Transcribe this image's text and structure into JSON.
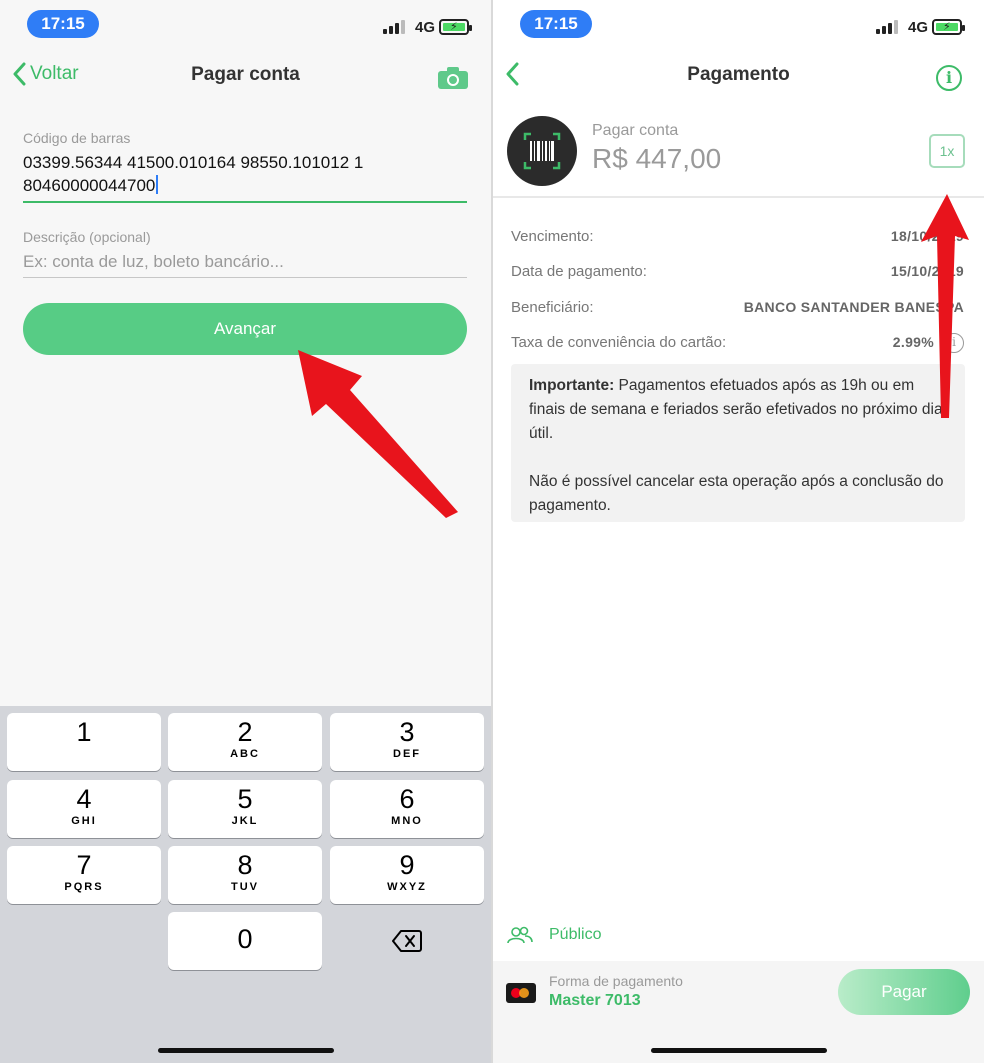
{
  "left_screen": {
    "status": {
      "time": "17:15",
      "network": "4G"
    },
    "nav": {
      "back_label": "Voltar",
      "title": "Pagar conta",
      "camera_icon": "camera-icon"
    },
    "barcode": {
      "label": "Código de barras",
      "value_line1": "03399.56344 41500.010164 98550.101012 1",
      "value_line2": "80460000044700"
    },
    "description": {
      "label": "Descrição (opcional)",
      "placeholder": "Ex: conta de luz, boleto bancário..."
    },
    "submit_label": "Avançar",
    "keypad": [
      {
        "num": "1",
        "letters": ""
      },
      {
        "num": "2",
        "letters": "ABC"
      },
      {
        "num": "3",
        "letters": "DEF"
      },
      {
        "num": "4",
        "letters": "GHI"
      },
      {
        "num": "5",
        "letters": "JKL"
      },
      {
        "num": "6",
        "letters": "MNO"
      },
      {
        "num": "7",
        "letters": "PQRS"
      },
      {
        "num": "8",
        "letters": "TUV"
      },
      {
        "num": "9",
        "letters": "WXYZ"
      },
      {
        "num": "0",
        "letters": ""
      }
    ]
  },
  "right_screen": {
    "status": {
      "time": "17:15",
      "network": "4G"
    },
    "nav": {
      "title": "Pagamento",
      "info_glyph": "i"
    },
    "summary": {
      "label": "Pagar conta",
      "amount": "R$ 447,00",
      "installments": "1x"
    },
    "details": [
      {
        "label": "Vencimento:",
        "value": "18/10/2019"
      },
      {
        "label": "Data de pagamento:",
        "value": "15/10/2019"
      },
      {
        "label": "Beneficiário:",
        "value": "BANCO SANTANDER BANESPA"
      },
      {
        "label": "Taxa de conveniência do cartão:",
        "value": "2.99%"
      }
    ],
    "notice": {
      "bold_prefix": "Importante:",
      "text1": " Pagamentos efetuados após as 19h ou em finais de semana e feriados serão efetivados no próximo dia útil.",
      "text2": "Não é possível cancelar esta operação após a conclusão do pagamento."
    },
    "visibility": "Público",
    "payment": {
      "label": "Forma de pagamento",
      "card": "Master 7013",
      "button": "Pagar"
    }
  },
  "colors": {
    "accent": "#3dbb68",
    "button": "#57cc85",
    "arrow": "#e8141c",
    "time_pill": "#2f7df6"
  }
}
